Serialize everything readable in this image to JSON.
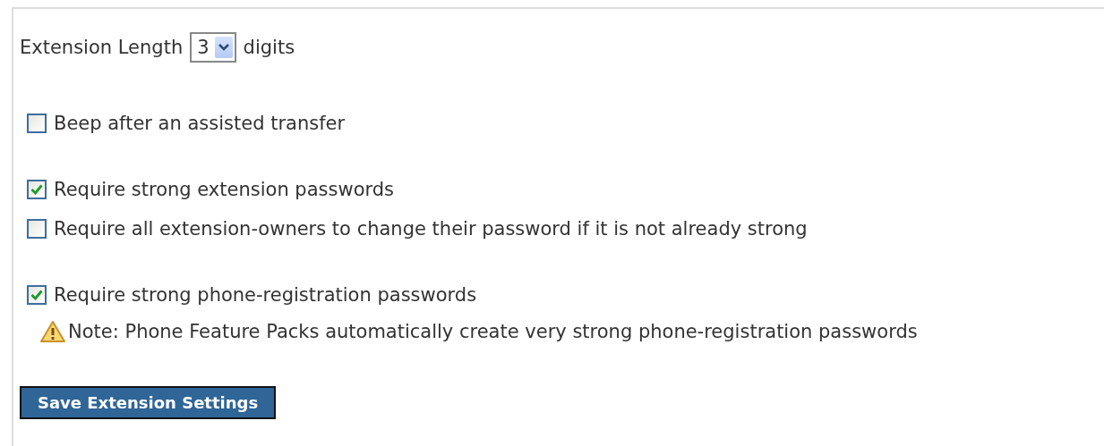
{
  "extension_length": {
    "label": "Extension Length",
    "value": "3",
    "unit": "digits"
  },
  "option_groups": [
    {
      "options": [
        {
          "label": "Beep after an assisted transfer",
          "checked": false
        }
      ]
    },
    {
      "options": [
        {
          "label": "Require strong extension passwords",
          "checked": true
        },
        {
          "label": "Require all extension-owners to change their password if it is not already strong",
          "checked": false
        }
      ]
    },
    {
      "options": [
        {
          "label": "Require strong phone-registration passwords",
          "checked": true
        }
      ],
      "note": "Note: Phone Feature Packs automatically create very strong phone-registration passwords"
    }
  ],
  "save_button": "Save Extension Settings"
}
